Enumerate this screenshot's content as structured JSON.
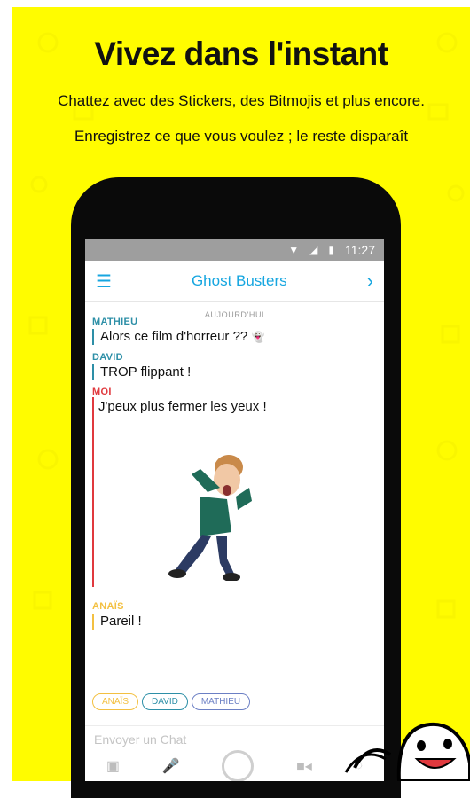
{
  "promo": {
    "headline": "Vivez dans l'instant",
    "line1": "Chattez avec des Stickers, des Bitmojis et plus encore.",
    "line2": "Enregistrez ce que vous voulez ; le reste disparaît",
    "background_color": "#fffc00"
  },
  "status_bar": {
    "time": "11:27",
    "icons": [
      "wifi-icon",
      "signal-icon",
      "battery-icon"
    ]
  },
  "chat_header": {
    "title": "Ghost Busters",
    "left_icon": "menu-icon",
    "right_icon": "chevron-right-icon",
    "accent": "#16a6e0"
  },
  "chat": {
    "date_label": "AUJOURD'HUI",
    "messages": [
      {
        "sender": "MATHIEU",
        "text": "Alors ce film d'horreur ??",
        "color": "#2d8fa7"
      },
      {
        "sender": "DAVID",
        "text": "TROP flippant !",
        "color": "#2d8fa7"
      },
      {
        "sender": "MOI",
        "text": "J'peux plus fermer les yeux !",
        "color": "#e0393e"
      },
      {
        "sender": "ANAÏS",
        "text": "Pareil !",
        "color": "#f3c041"
      }
    ]
  },
  "participants": [
    "ANAÏS",
    "DAVID",
    "MATHIEU"
  ],
  "composer": {
    "placeholder": "Envoyer un Chat"
  },
  "toolbar_icons": [
    "image-icon",
    "microphone-icon",
    "capture-button",
    "video-icon",
    "sticker-icon"
  ]
}
